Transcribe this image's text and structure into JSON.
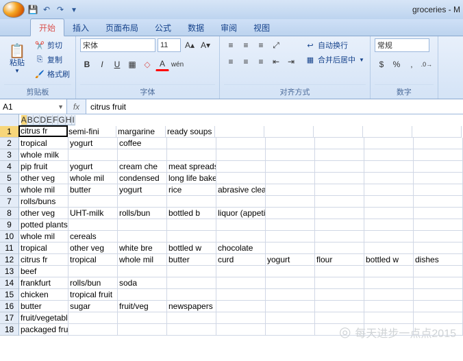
{
  "title": "groceries - M",
  "tabs": {
    "t0": "开始",
    "t1": "插入",
    "t2": "页面布局",
    "t3": "公式",
    "t4": "数据",
    "t5": "审阅",
    "t6": "视图"
  },
  "clipboard": {
    "paste": "粘贴",
    "cut": "剪切",
    "copy": "复制",
    "format": "格式刷",
    "label": "剪贴板"
  },
  "font": {
    "name": "宋体",
    "size": "11",
    "label": "字体"
  },
  "align": {
    "wrap": "自动换行",
    "merge": "合并后居中",
    "label": "对齐方式"
  },
  "number": {
    "style": "常规",
    "label": "数字"
  },
  "namebox": "A1",
  "fx": "fx",
  "formula": "citrus fruit",
  "cols": [
    "A",
    "B",
    "C",
    "D",
    "E",
    "F",
    "G",
    "H",
    "I"
  ],
  "grid": [
    [
      "citrus fr",
      "semi-fini",
      "margarine",
      "ready soups",
      "",
      "",
      "",
      "",
      ""
    ],
    [
      "tropical",
      "yogurt",
      "coffee",
      "",
      "",
      "",
      "",
      "",
      ""
    ],
    [
      "whole milk",
      "",
      "",
      "",
      "",
      "",
      "",
      "",
      ""
    ],
    [
      "pip fruit",
      "yogurt",
      "cream che",
      "meat spreads",
      "",
      "",
      "",
      "",
      ""
    ],
    [
      "other veg",
      "whole mil",
      "condensed",
      "long life bakery product",
      "",
      "",
      "",
      "",
      ""
    ],
    [
      "whole mil",
      "butter",
      "yogurt",
      "rice",
      "abrasive cleaner",
      "",
      "",
      "",
      ""
    ],
    [
      "rolls/buns",
      "",
      "",
      "",
      "",
      "",
      "",
      "",
      ""
    ],
    [
      "other veg",
      "UHT-milk",
      "rolls/bun",
      "bottled b",
      "liquor (appetizer)",
      "",
      "",
      "",
      ""
    ],
    [
      "potted plants",
      "",
      "",
      "",
      "",
      "",
      "",
      "",
      ""
    ],
    [
      "whole mil",
      "cereals",
      "",
      "",
      "",
      "",
      "",
      "",
      ""
    ],
    [
      "tropical",
      "other veg",
      "white bre",
      "bottled w",
      "chocolate",
      "",
      "",
      "",
      ""
    ],
    [
      "citrus fr",
      "tropical",
      "whole mil",
      "butter",
      "curd",
      "yogurt",
      "flour",
      "bottled w",
      "dishes"
    ],
    [
      "beef",
      "",
      "",
      "",
      "",
      "",
      "",
      "",
      ""
    ],
    [
      "frankfurt",
      "rolls/bun",
      "soda",
      "",
      "",
      "",
      "",
      "",
      ""
    ],
    [
      "chicken",
      "tropical fruit",
      "",
      "",
      "",
      "",
      "",
      "",
      ""
    ],
    [
      "butter",
      "sugar",
      "fruit/veg",
      "newspapers",
      "",
      "",
      "",
      "",
      ""
    ],
    [
      "fruit/vegetable juice",
      "",
      "",
      "",
      "",
      "",
      "",
      "",
      ""
    ],
    [
      "packaged fruit/vegetables",
      "",
      "",
      "",
      "",
      "",
      "",
      "",
      ""
    ]
  ],
  "watermark": "每天进步一点点2015"
}
